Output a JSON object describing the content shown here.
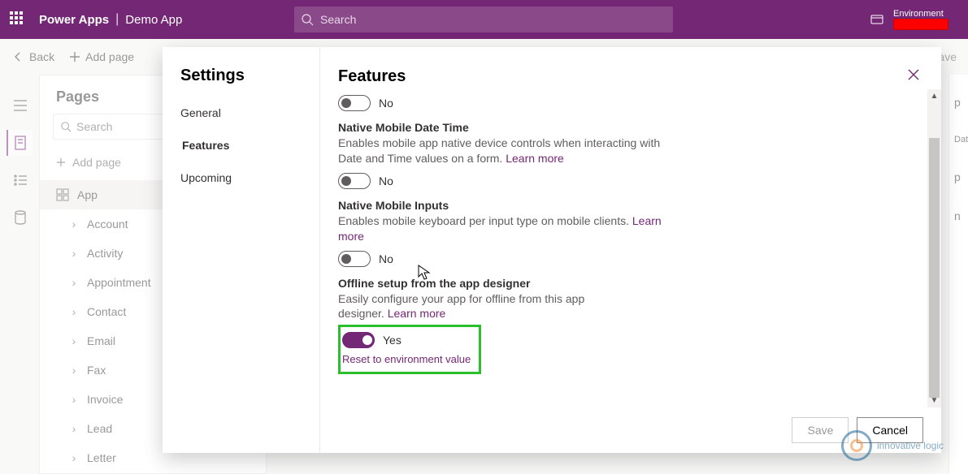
{
  "header": {
    "brand": "Power Apps",
    "app_name": "Demo App",
    "search_placeholder": "Search",
    "environment_label": "Environment"
  },
  "cmdbar": {
    "back": "Back",
    "add_page": "Add page",
    "save": "Save"
  },
  "pages_panel": {
    "title": "Pages",
    "search_placeholder": "Search",
    "add_page": "Add page",
    "app_node": "App",
    "children": [
      "Account",
      "Activity",
      "Appointment",
      "Contact",
      "Email",
      "Fax",
      "Invoice",
      "Lead",
      "Letter"
    ]
  },
  "right_partial": {
    "a": "p",
    "b": "Data",
    "c": "p",
    "d": "n"
  },
  "modal": {
    "side_title": "Settings",
    "nav": {
      "general": "General",
      "features": "Features",
      "upcoming": "Upcoming"
    },
    "title": "Features",
    "partial_toggle_label": "No",
    "features": {
      "native_dt": {
        "title": "Native Mobile Date Time",
        "desc_a": "Enables mobile app native device controls when interacting with Date and Time values on a form. ",
        "learn": "Learn more",
        "toggle_label": "No"
      },
      "native_inputs": {
        "title": "Native Mobile Inputs",
        "desc_a": "Enables mobile keyboard per input type on mobile clients. ",
        "learn": "Learn more",
        "toggle_label": "No"
      },
      "offline": {
        "title": "Offline setup from the app designer",
        "desc_a": "Easily configure your app for offline from this app designer. ",
        "learn": "Learn more",
        "toggle_label": "Yes",
        "reset": "Reset to environment value"
      }
    },
    "footer": {
      "save": "Save",
      "cancel": "Cancel"
    }
  },
  "watermark": {
    "text": "innovative logic"
  }
}
